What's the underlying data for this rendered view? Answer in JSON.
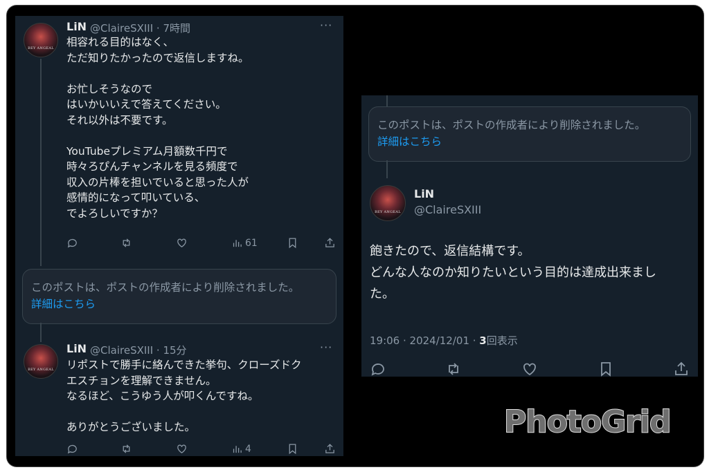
{
  "left": {
    "tweet1": {
      "name": "LiN",
      "handle": "@ClaireSXIII · 7時間",
      "more": "···",
      "avatar_text": "BEY ANGEAL",
      "text": "相容れる目的はなく、\nただ知りたかったので返信しますね。\n\nお忙しそうなので\nはいかいいえで答えてください。\nそれ以外は不要です。\n\nYouTubeプレミアム月額数千円で\n時々ろぴんチャンネルを見る頻度で\n収入の片棒を担いでいると思った人が\n感情的になって叩いている、\nでよろしいですか？",
      "views": "61"
    },
    "deleted": {
      "message": "このポストは、ポストの作成者により削除されました。",
      "link": "詳細はこちら"
    },
    "tweet2": {
      "name": "LiN",
      "handle": "@ClaireSXIII · 15分",
      "more": "···",
      "avatar_text": "BEY ANGEAL",
      "text": "リポストで勝手に絡んできた挙句、クローズドク\nエスチョンを理解できません。\nなるほど、こうゆう人が叩くんですね。\n\nありがとうございました。",
      "views": "4"
    }
  },
  "right": {
    "deleted": {
      "message": "このポストは、ポストの作成者により削除されました。",
      "link": "詳細はこちら"
    },
    "tweet": {
      "name": "LiN",
      "handle": "@ClaireSXIII",
      "avatar_text": "BEY ANGEAL",
      "text": "飽きたので、返信結構です。\nどんな人なのか知りたいという目的は達成出来まし\nた。",
      "meta_prefix": "19:06 · 2024/12/01 · ",
      "view_count": "3",
      "view_suffix": "回表示"
    }
  },
  "watermark": "PhotoGrid",
  "icons": [
    "reply-icon",
    "retweet-icon",
    "like-icon",
    "views-icon",
    "bookmark-icon",
    "share-icon"
  ]
}
